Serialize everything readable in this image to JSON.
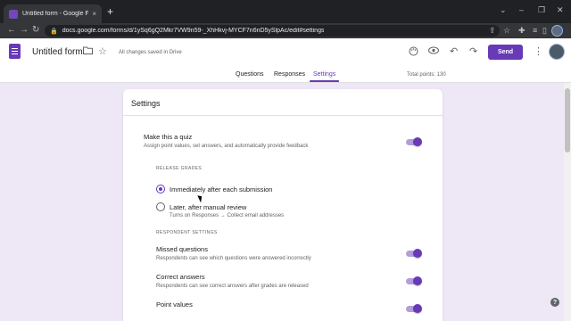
{
  "browser": {
    "tab_title": "Untitled form - Google Forms",
    "tab_close": "×",
    "new_tab": "+",
    "url": "docs.google.com/forms/d/1ySq6gQ2Mkr7VW9n59-_XhHkvj-MYCF7n6nD5ySlpAc/edit#settings",
    "icons": [
      "back-icon",
      "forward-icon",
      "reload-icon",
      "lock-icon",
      "share-icon",
      "star-icon",
      "extensions-icon",
      "reading-list-icon",
      "sidebar-icon"
    ],
    "window_controls": [
      "⌄",
      "–",
      "❐",
      "✕"
    ]
  },
  "header": {
    "form_title": "Untitled form",
    "save_status": "All changes saved in Drive",
    "send_label": "Send",
    "icons": [
      "folder-icon",
      "star-icon",
      "palette-icon",
      "preview-icon",
      "undo-icon",
      "redo-icon",
      "more-icon"
    ]
  },
  "tabs": [
    {
      "label": "Questions",
      "active": false
    },
    {
      "label": "Responses",
      "active": false
    },
    {
      "label": "Settings",
      "active": true
    }
  ],
  "total_points": "Total points: 130",
  "settings": {
    "title": "Settings",
    "quiz": {
      "label": "Make this a quiz",
      "description": "Assign point values, set answers, and automatically provide feedback",
      "enabled": true
    },
    "release_grades": {
      "heading": "RELEASE GRADES",
      "options": [
        {
          "label": "Immediately after each submission",
          "checked": true,
          "sub": ""
        },
        {
          "label": "Later, after manual review",
          "checked": false,
          "sub": "Turns on Responses → Collect email addresses"
        }
      ]
    },
    "respondent_settings": {
      "heading": "RESPONDENT SETTINGS",
      "items": [
        {
          "label": "Missed questions",
          "description": "Respondents can see which questions were answered incorrectly",
          "enabled": true
        },
        {
          "label": "Correct answers",
          "description": "Respondents can see correct answers after grades are released",
          "enabled": true
        },
        {
          "label": "Point values",
          "description": "",
          "enabled": true
        }
      ]
    }
  },
  "help_label": "?",
  "colors": {
    "accent": "#673ab7",
    "background": "#ede7f6",
    "toggle_track": "#b39ddb"
  }
}
